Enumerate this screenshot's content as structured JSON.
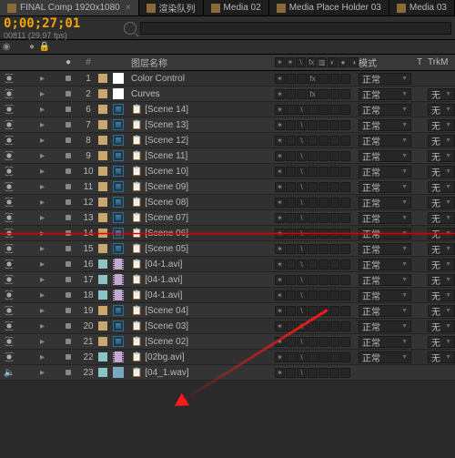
{
  "tabs": [
    {
      "label": "FINAL Comp 1920x1080",
      "active": true
    },
    {
      "label": "渲染队列",
      "active": false
    },
    {
      "label": "Media 02",
      "active": false
    },
    {
      "label": "Media Place Holder 03",
      "active": false
    },
    {
      "label": "Media 03",
      "active": false
    }
  ],
  "timecode": "0;00;27;01",
  "frames": "00811 (29.97 fps)",
  "header": {
    "num": "#",
    "name": "图层名称",
    "mode": "模式",
    "t": "T",
    "trk": "TrkM"
  },
  "switch_labels": [
    "✶",
    "✶",
    "\\",
    "fx",
    "▥",
    "◐",
    "●",
    "◑"
  ],
  "mode_normal": "正常",
  "trk_none": "无",
  "layers": [
    {
      "n": 1,
      "swatch": "#c9a870",
      "type": "fx",
      "name": "Color Control",
      "eye": true,
      "spk": false,
      "mode": true,
      "trk": false,
      "fx": true
    },
    {
      "n": 2,
      "swatch": "#c9a870",
      "type": "fx",
      "name": "Curves",
      "eye": true,
      "spk": false,
      "mode": true,
      "trk": true,
      "fx": true
    },
    {
      "n": 6,
      "swatch": "#c9a870",
      "type": "comp",
      "name": "[Scene 14]",
      "eye": true,
      "spk": false,
      "mode": true,
      "trk": true,
      "br": true
    },
    {
      "n": 7,
      "swatch": "#c9a870",
      "type": "comp",
      "name": "[Scene 13]",
      "eye": true,
      "spk": false,
      "mode": true,
      "trk": true,
      "br": true
    },
    {
      "n": 8,
      "swatch": "#c9a870",
      "type": "comp",
      "name": "[Scene 12]",
      "eye": true,
      "spk": false,
      "mode": true,
      "trk": true,
      "br": true
    },
    {
      "n": 9,
      "swatch": "#c9a870",
      "type": "comp",
      "name": "[Scene 11]",
      "eye": true,
      "spk": false,
      "mode": true,
      "trk": true,
      "br": true
    },
    {
      "n": 10,
      "swatch": "#c9a870",
      "type": "comp",
      "name": "[Scene 10]",
      "eye": true,
      "spk": false,
      "mode": true,
      "trk": true,
      "br": true
    },
    {
      "n": 11,
      "swatch": "#c9a870",
      "type": "comp",
      "name": "[Scene 09]",
      "eye": true,
      "spk": false,
      "mode": true,
      "trk": true,
      "br": true
    },
    {
      "n": 12,
      "swatch": "#c9a870",
      "type": "comp",
      "name": "[Scene 08]",
      "eye": true,
      "spk": false,
      "mode": true,
      "trk": true,
      "br": true
    },
    {
      "n": 13,
      "swatch": "#c9a870",
      "type": "comp",
      "name": "[Scene 07]",
      "eye": true,
      "spk": false,
      "mode": true,
      "trk": true,
      "br": true
    },
    {
      "n": 14,
      "swatch": "#c9a870",
      "type": "comp",
      "name": "[Scene 06]",
      "eye": true,
      "spk": false,
      "mode": true,
      "trk": true,
      "br": true,
      "red": true
    },
    {
      "n": 15,
      "swatch": "#c9a870",
      "type": "comp",
      "name": "[Scene 05]",
      "eye": true,
      "spk": false,
      "mode": true,
      "trk": true,
      "br": true
    },
    {
      "n": 16,
      "swatch": "#8ac4c4",
      "type": "vid",
      "name": "[04-1.avi]",
      "eye": true,
      "spk": false,
      "mode": true,
      "trk": true,
      "br": true
    },
    {
      "n": 17,
      "swatch": "#8ac4c4",
      "type": "vid",
      "name": "[04-1.avi]",
      "eye": true,
      "spk": false,
      "mode": true,
      "trk": true,
      "br": true
    },
    {
      "n": 18,
      "swatch": "#8ac4c4",
      "type": "vid",
      "name": "[04-1.avi]",
      "eye": true,
      "spk": false,
      "mode": true,
      "trk": true,
      "br": true
    },
    {
      "n": 19,
      "swatch": "#c9a870",
      "type": "comp",
      "name": "[Scene 04]",
      "eye": true,
      "spk": false,
      "mode": true,
      "trk": true,
      "br": true
    },
    {
      "n": 20,
      "swatch": "#c9a870",
      "type": "comp",
      "name": "[Scene 03]",
      "eye": true,
      "spk": false,
      "mode": true,
      "trk": true,
      "br": true
    },
    {
      "n": 21,
      "swatch": "#c9a870",
      "type": "comp",
      "name": "[Scene 02]",
      "eye": true,
      "spk": false,
      "mode": true,
      "trk": true,
      "br": true
    },
    {
      "n": 22,
      "swatch": "#8ac4c4",
      "type": "vid",
      "name": "[02bg.avi]",
      "eye": true,
      "spk": false,
      "mode": true,
      "trk": true,
      "br": true
    },
    {
      "n": 23,
      "swatch": "#8ac4c4",
      "type": "aud",
      "name": "[04_1.wav]",
      "eye": false,
      "spk": true,
      "mode": false,
      "trk": false,
      "br": true
    }
  ]
}
